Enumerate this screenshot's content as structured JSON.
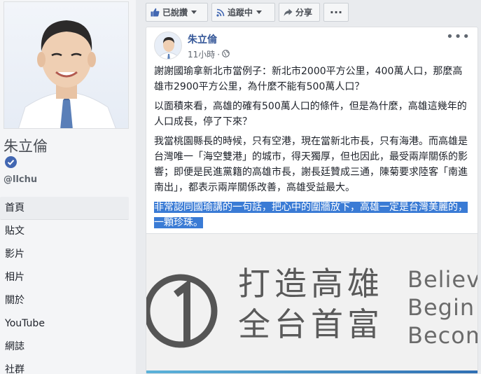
{
  "sidebar": {
    "page_name": "朱立倫",
    "handle": "@llchu",
    "nav": [
      {
        "label": "首頁",
        "active": true
      },
      {
        "label": "貼文"
      },
      {
        "label": "影片"
      },
      {
        "label": "相片"
      },
      {
        "label": "關於"
      },
      {
        "label": "YouTube"
      },
      {
        "label": "網誌"
      },
      {
        "label": "社群"
      }
    ],
    "verified_icon": "verified-badge-icon"
  },
  "actions": {
    "liked": "已說讚",
    "following": "追蹤中",
    "share": "分享",
    "more": "···"
  },
  "post": {
    "author": "朱立倫",
    "time": "11小時",
    "separator": "·",
    "privacy_icon": "globe-icon",
    "more": "•••",
    "paragraphs": [
      "謝謝國瑜拿新北市當例子：新北市2000平方公里，400萬人口，那麼高雄市2900平方公里，為什麼不能有500萬人口？",
      "以面積來看，高雄的確有500萬人口的條件，但是為什麼，高雄這幾年的人口成長，停了下來？",
      "我當桃園縣長的時候，只有空港，現在當新北市長，只有海港。而高雄是台灣唯一「海空雙港」的城市，得天獨厚，但也因此，最受兩岸關係的影響；即便是民進黨籍的高雄市長，謝長廷贊成三通，陳菊要求陸客「南進南出」，都表示兩岸關係改善，高雄受益最大。"
    ],
    "highlighted": "非常認同國瑜講的一句話，把心中的圍牆放下，高雄一定是台灣美麗的，一顆珍珠。",
    "image": {
      "line1": "打造高雄",
      "line2": "全台首富",
      "en": [
        "Believe",
        "Begin",
        "Become"
      ]
    }
  },
  "colors": {
    "link": "#365899",
    "highlight": "#3a7bd5",
    "verified": "#4267b2"
  }
}
